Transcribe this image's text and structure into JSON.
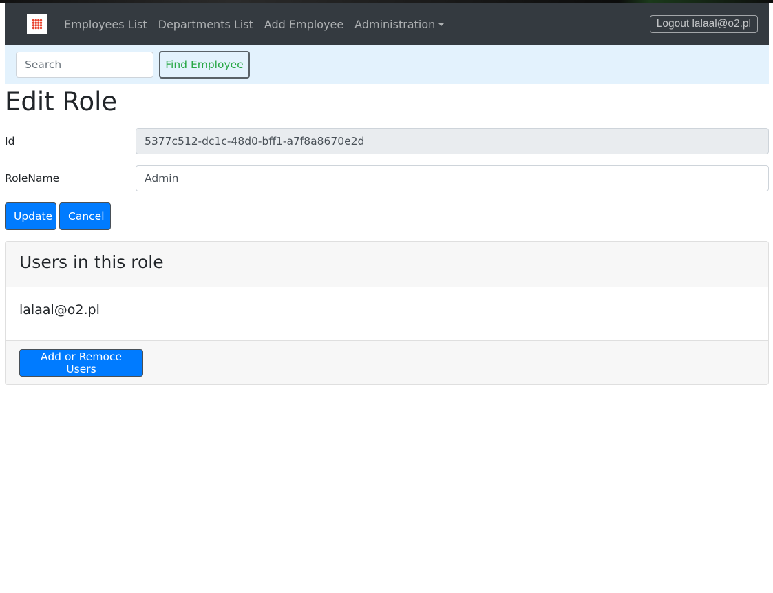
{
  "navbar": {
    "brand_icon": "grid-dots-icon",
    "brand_color": "#e8412c",
    "links": [
      {
        "label": "Employees List"
      },
      {
        "label": "Departments List"
      },
      {
        "label": "Add Employee"
      },
      {
        "label": "Administration"
      }
    ],
    "logout_label": "Logout lalaal@o2.pl"
  },
  "search": {
    "placeholder": "Search",
    "button_label": "Find Employee"
  },
  "page": {
    "title": "Edit Role"
  },
  "form": {
    "id_label": "Id",
    "id_value": "5377c512-dc1c-48d0-bff1-a7f8a8670e2d",
    "rolename_label": "RoleName",
    "rolename_value": "Admin",
    "update_label": "Update",
    "cancel_label": "Cancel"
  },
  "users_card": {
    "title": "Users in this role",
    "users": [
      "lalaal@o2.pl"
    ],
    "add_remove_label": "Add or Remoce Users"
  },
  "colors": {
    "navbar_bg": "#343a40",
    "searchbar_bg": "#e3f2fd",
    "primary": "#007bff",
    "success": "#28a745"
  }
}
